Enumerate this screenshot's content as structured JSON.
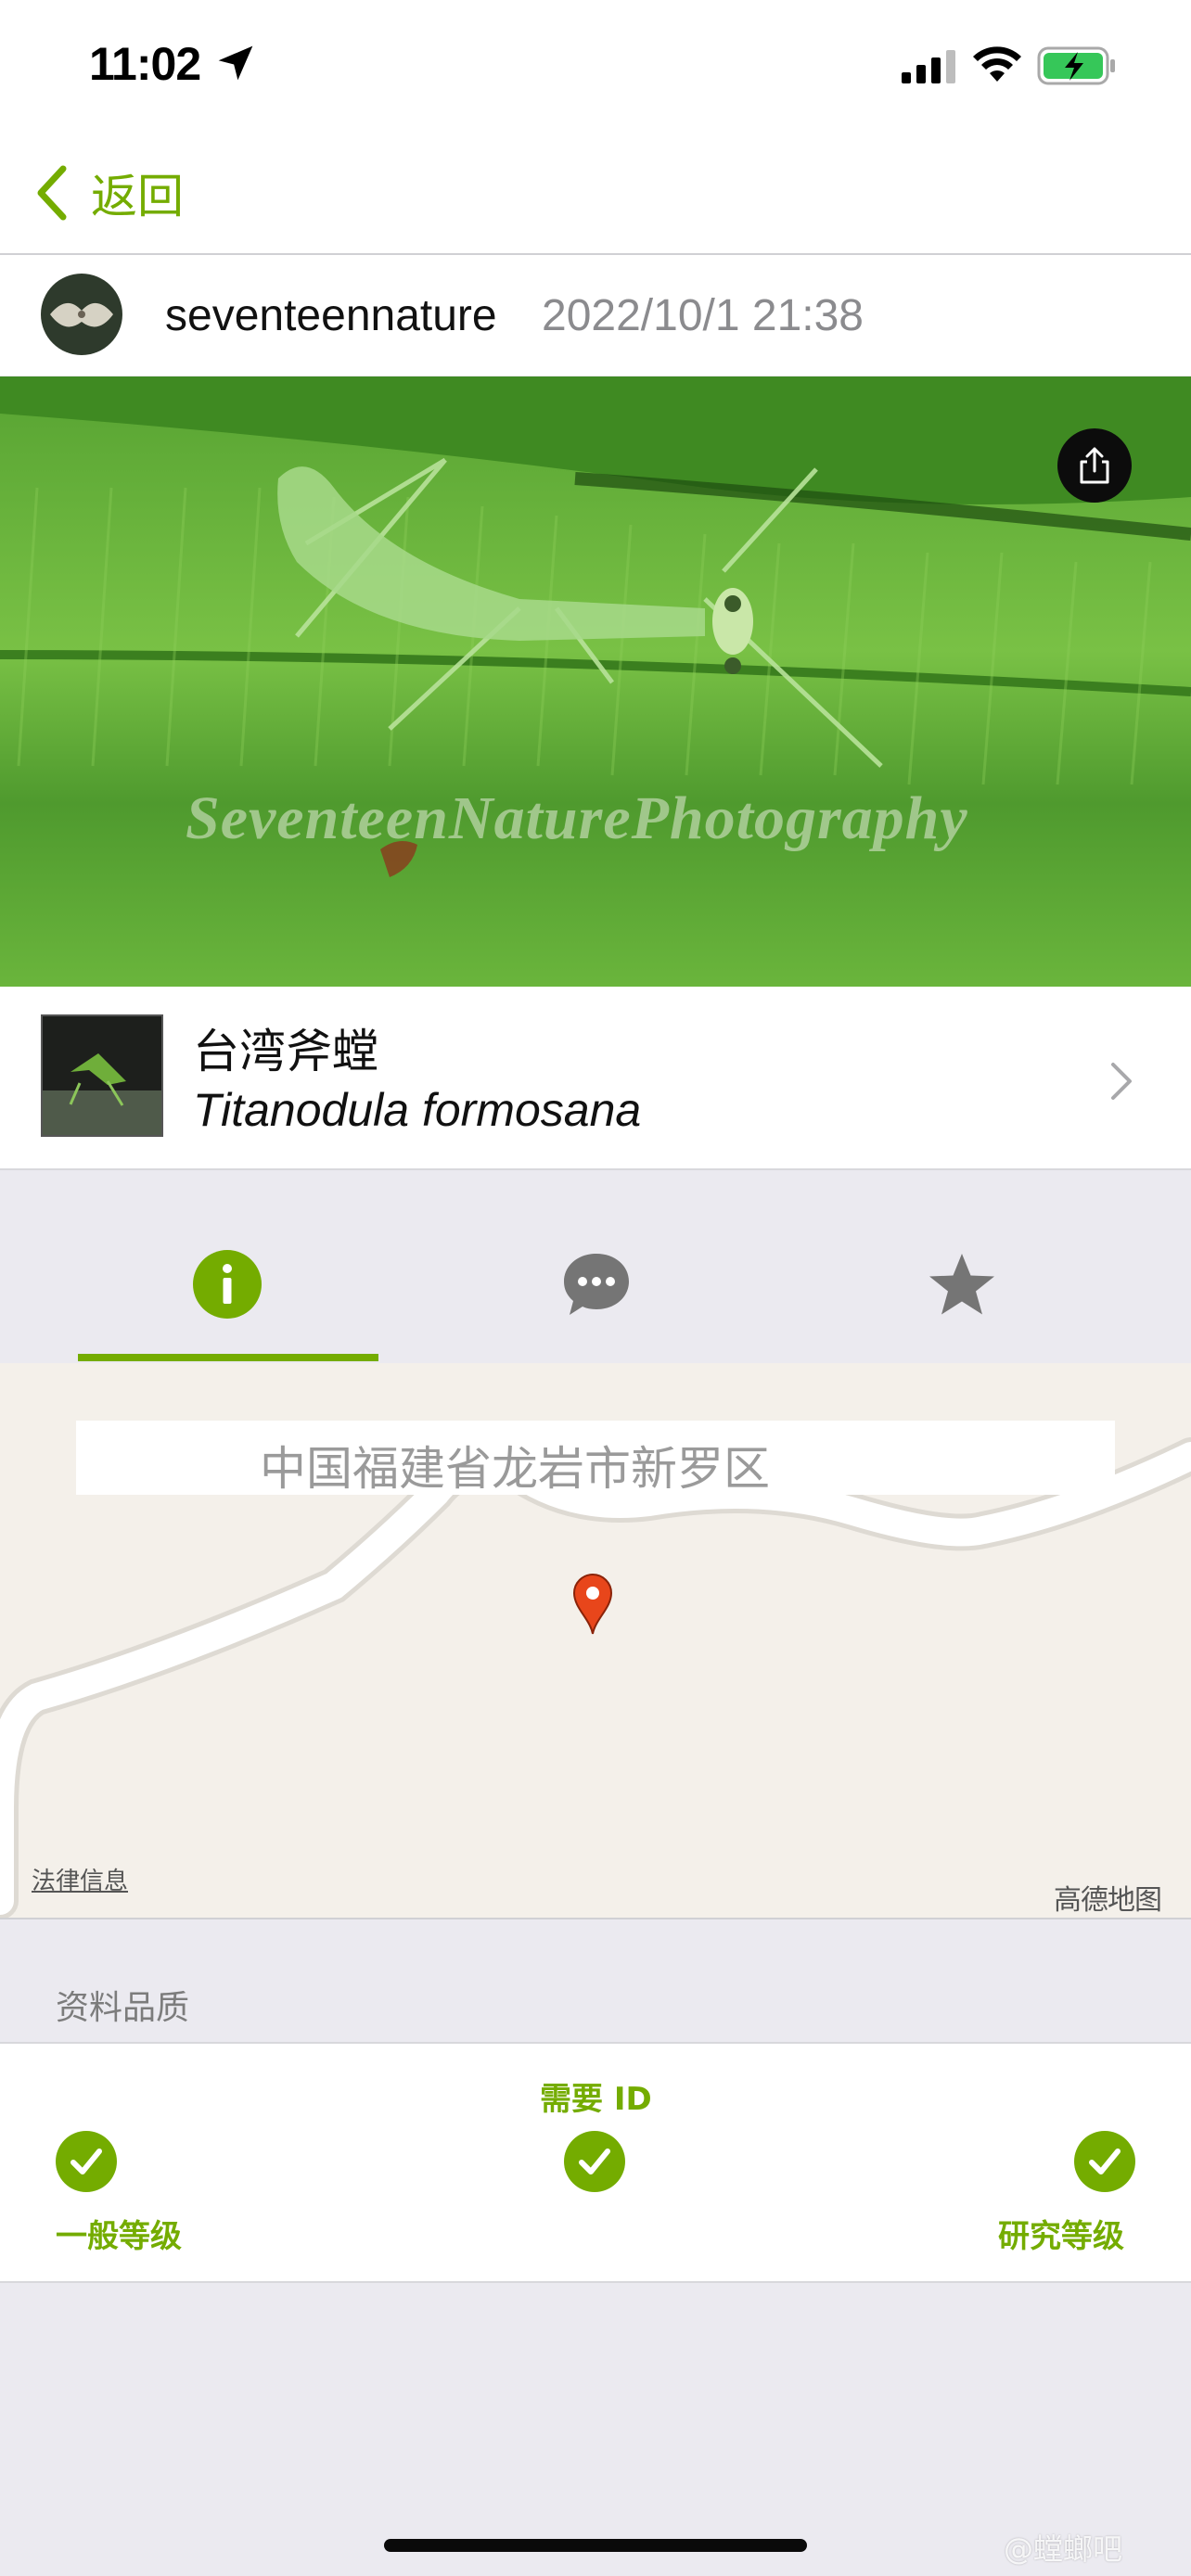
{
  "status_bar": {
    "time": "11:02",
    "icons": [
      "location-arrow-icon",
      "cellular-signal-icon",
      "wifi-icon",
      "battery-charging-icon"
    ]
  },
  "nav": {
    "back_label": "返回",
    "back_icon": "chevron-left-icon"
  },
  "observation": {
    "username": "seventeennature",
    "date": "2022/10/1 21:38",
    "photo_watermark": "SeventeenNaturePhotography",
    "share_icon": "share-icon"
  },
  "taxon": {
    "common_name": "台湾斧螳",
    "scientific_name": "Titanodula formosana"
  },
  "tabs": [
    {
      "name": "info",
      "icon": "info-icon",
      "active": true
    },
    {
      "name": "comments",
      "icon": "speech-bubble-icon",
      "active": false
    },
    {
      "name": "favorites",
      "icon": "star-icon",
      "active": false
    }
  ],
  "map": {
    "place": "中国福建省龙岩市新罗区",
    "legal_link": "法律信息",
    "provider_logo": "高德地图"
  },
  "data_quality": {
    "header": "资料品质",
    "levels": [
      "一般等级",
      "需要 ID",
      "研究等级"
    ]
  },
  "footer": {
    "watermark": "@螳螂吧"
  },
  "colors": {
    "accent": "#74ac00",
    "background": "#ebeaf0",
    "map_background": "#f4f0ea",
    "map_pin": "#e8461b"
  }
}
